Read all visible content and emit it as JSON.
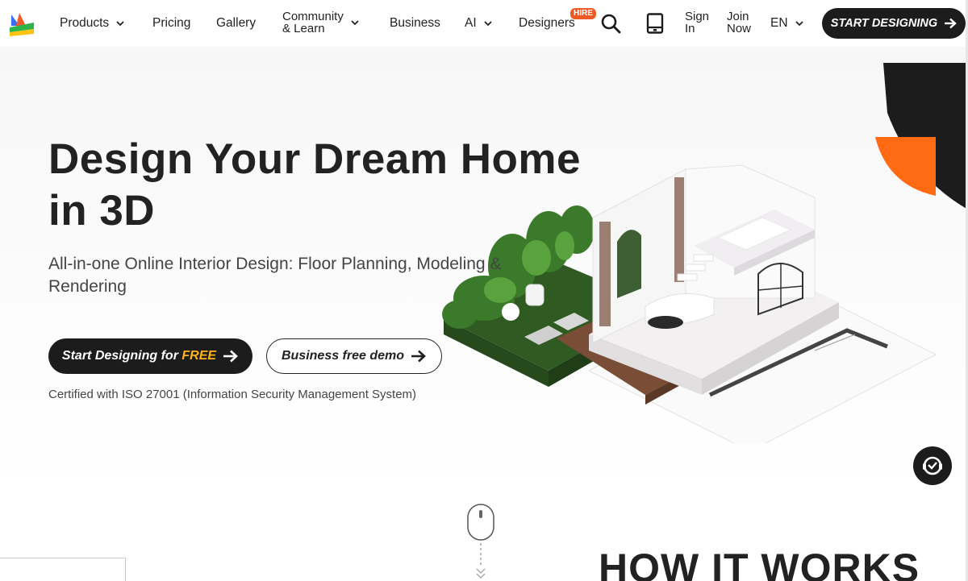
{
  "nav": {
    "products": "Products",
    "pricing": "Pricing",
    "gallery": "Gallery",
    "community_line1": "Community",
    "community_line2": "& Learn",
    "business": "Business",
    "ai": "AI",
    "designers": "Designers",
    "hire_badge": "HIRE",
    "sign_in_line1": "Sign",
    "sign_in_line2": "In",
    "join_line1": "Join",
    "join_line2": "Now",
    "language": "EN",
    "start_designing": "START DESIGNING"
  },
  "hero": {
    "title_line1": "Design Your Dream Home",
    "title_line2": "in 3D",
    "subtitle": "All-in-one Online Interior Design: Floor Planning, Modeling & Rendering",
    "cta_primary_text": "Start Designing for",
    "cta_primary_highlight": "FREE",
    "cta_secondary": "Business free demo",
    "certification": "Certified with ISO 27001 (Information Security Management System)"
  },
  "section": {
    "how_it_works": "HOW IT WORKS"
  },
  "colors": {
    "accent_orange": "#ff6a13",
    "dark": "#1c1c1c",
    "free_highlight": "#ffb21a",
    "hire_badge": "#ef5a24"
  },
  "icons": [
    "logo-icon",
    "chevron-down-icon",
    "search-icon",
    "tablet-icon",
    "arrow-right-icon",
    "chat-support-icon",
    "mouse-scroll-icon"
  ]
}
